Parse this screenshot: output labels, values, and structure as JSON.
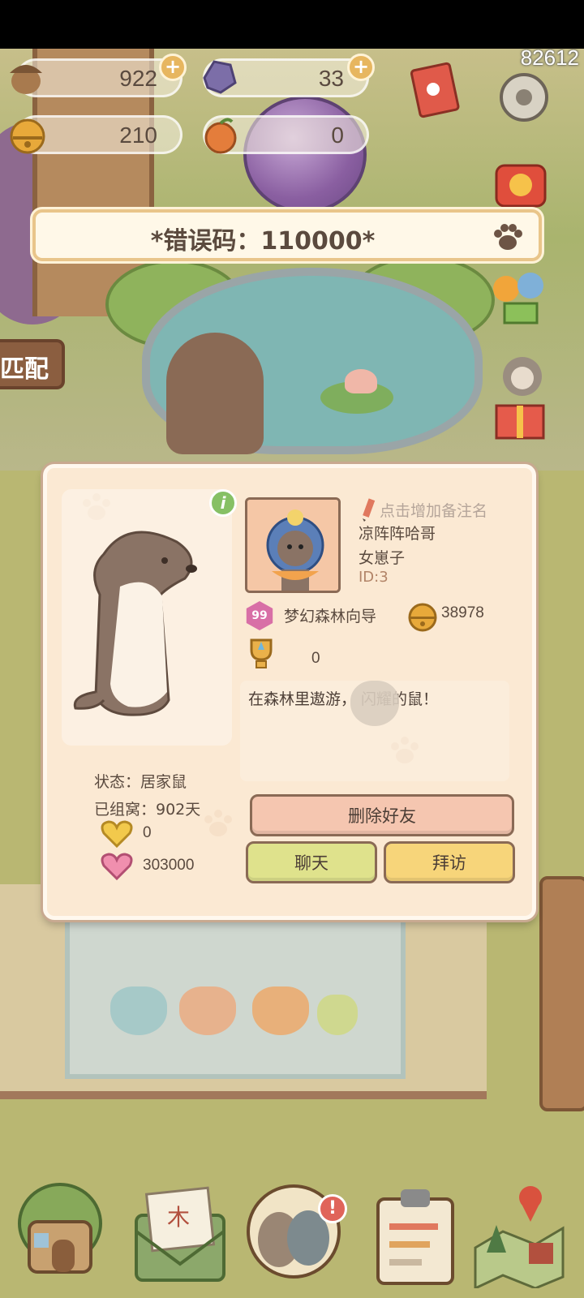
{
  "hud": {
    "acorn_count": "922",
    "gem_count": "33",
    "bell_count": "210",
    "fruit_count": "0",
    "top_number": "82612"
  },
  "banner": {
    "text": "*错误码：110000*"
  },
  "left_sign": {
    "text": "匹配"
  },
  "profile": {
    "remark_placeholder": "点击增加备注名",
    "nickname": "凉阵阵哈哥",
    "title": "女崽子",
    "id": "ID:3",
    "level": "99",
    "level_name": "梦幻森林向导",
    "bells": "38978",
    "trophies": "0",
    "bio": "在森林里遨游，      闪耀的鼠！",
    "status": "状态：居家鼠",
    "nest_days": "已组窝：902天",
    "gold_hearts": "0",
    "pink_hearts": "303000"
  },
  "buttons": {
    "delete_friend": "删除好友",
    "chat": "聊天",
    "visit": "拜访"
  },
  "nav": {
    "badge": "!",
    "items": [
      "home-icon",
      "mail-icon",
      "friends-icon",
      "clipboard-icon",
      "map-icon"
    ]
  },
  "colors": {
    "dialog_bg": "#fbe9d3",
    "delete_btn": "#f5c6b0",
    "chat_btn": "#dfe28c",
    "visit_btn": "#f7d57a",
    "banner_border": "#e9c58a"
  }
}
